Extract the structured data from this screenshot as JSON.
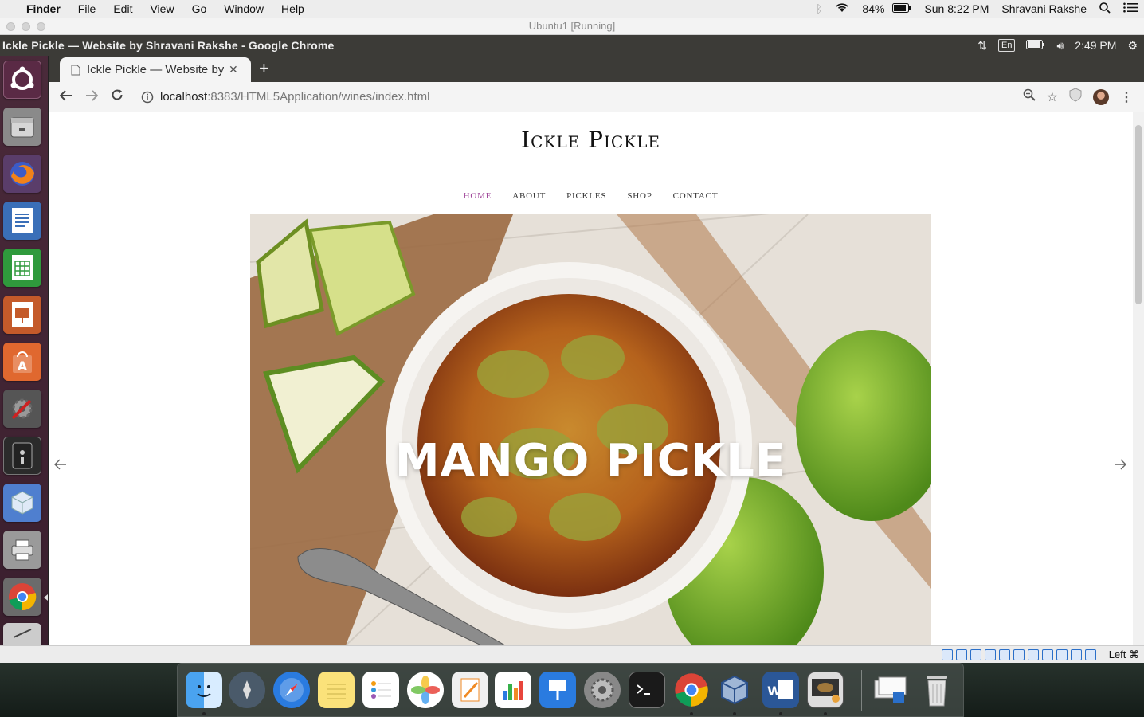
{
  "mac_menubar": {
    "app": "Finder",
    "menus": [
      "File",
      "Edit",
      "View",
      "Go",
      "Window",
      "Help"
    ],
    "battery": "84%",
    "datetime": "Sun 8:22 PM",
    "user": "Shravani Rakshe"
  },
  "vbox": {
    "title": "Ubuntu1 [Running]",
    "host_key": "Left ⌘"
  },
  "ubuntu": {
    "window_title": "Ickle Pickle — Website by Shravani Rakshe - Google Chrome",
    "keyboard": "En",
    "time": "2:49 PM"
  },
  "chrome": {
    "tab_title": "Ickle Pickle — Website by Shravani Rakshe",
    "url_host": "localhost",
    "url_path": ":8383/HTML5Application/wines/index.html"
  },
  "site": {
    "brand": "Ickle Pickle",
    "nav": [
      "HOME",
      "ABOUT",
      "PICKLES",
      "SHOP",
      "CONTACT"
    ],
    "active_nav": "HOME",
    "hero_title": "MANGO PICKLE",
    "colors": {
      "accent": "#a1499b"
    }
  },
  "icons": {
    "launcher": [
      "ubuntu-icon",
      "files-icon",
      "firefox-icon",
      "writer-icon",
      "calc-icon",
      "impress-icon",
      "software-center-icon",
      "settings-icon",
      "terminal-icon",
      "cube-icon",
      "printer-icon",
      "chrome-icon",
      "text-editor-icon"
    ],
    "dock": [
      "finder-icon",
      "launchpad-icon",
      "safari-icon",
      "notes-icon",
      "reminders-icon",
      "photos-icon",
      "pages-icon",
      "numbers-icon",
      "keynote-icon",
      "system-preferences-icon",
      "terminal-icon",
      "chrome-icon",
      "virtualbox-icon",
      "word-icon",
      "photo-booth-icon",
      "downloads-icon",
      "trash-icon"
    ]
  }
}
